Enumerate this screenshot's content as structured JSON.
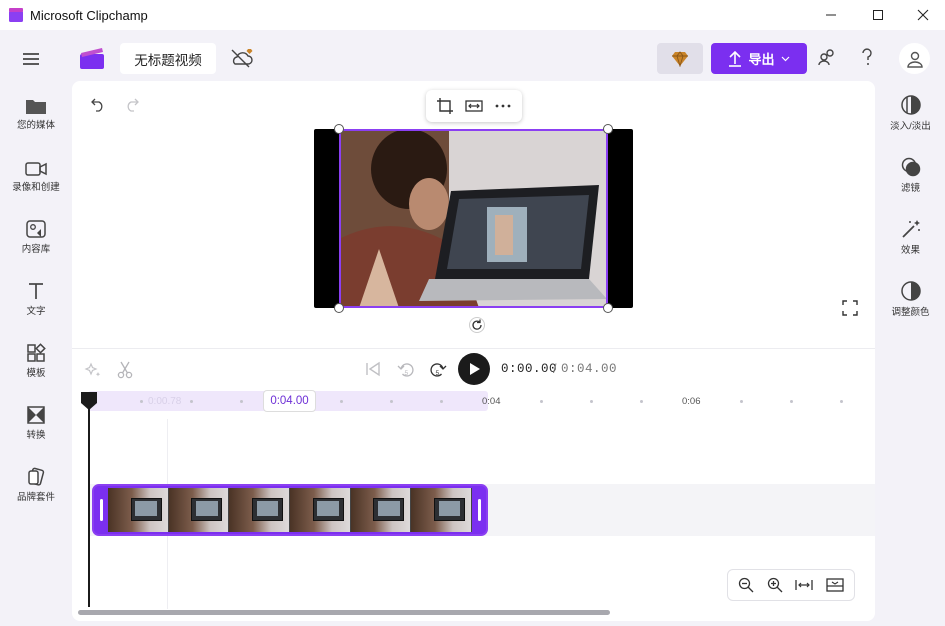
{
  "window": {
    "title": "Microsoft Clipchamp",
    "controls": [
      "minimize",
      "maximize",
      "close"
    ]
  },
  "topbar": {
    "project_title": "无标题视频",
    "export_label": "导出",
    "icons": [
      "menu-icon",
      "clipchamp-logo-icon",
      "cloud-off-icon",
      "premium-diamond-icon",
      "upload-icon",
      "chevron-down-icon",
      "share-people-icon",
      "help-icon",
      "user-avatar-icon"
    ]
  },
  "left_nav": {
    "items": [
      {
        "label": "您的媒体",
        "icon": "folder-icon"
      },
      {
        "label": "录像和创建",
        "icon": "video-camera-icon"
      },
      {
        "label": "内容库",
        "icon": "library-icon"
      },
      {
        "label": "文字",
        "icon": "text-icon"
      },
      {
        "label": "模板",
        "icon": "templates-icon"
      },
      {
        "label": "转换",
        "icon": "transitions-icon"
      },
      {
        "label": "品牌套件",
        "icon": "brand-kit-icon"
      }
    ]
  },
  "right_nav": {
    "items": [
      {
        "label": "淡入/淡出",
        "icon": "fade-icon"
      },
      {
        "label": "滤镜",
        "icon": "filters-icon"
      },
      {
        "label": "效果",
        "icon": "effects-wand-icon"
      },
      {
        "label": "调整颜色",
        "icon": "adjust-colors-icon"
      }
    ]
  },
  "preview": {
    "toolbar": [
      "crop-icon",
      "fit-icon",
      "more-icon"
    ],
    "icons": [
      "undo-icon",
      "redo-icon",
      "rotate-icon",
      "fullscreen-icon"
    ]
  },
  "playback": {
    "current_time": "0:00.00",
    "separator": "/",
    "total_time": "0:04.00"
  },
  "timeline": {
    "ghost_label": "0:00.78",
    "time_chip": "0:04.00",
    "ruler_labels": [
      "0:04",
      "0:06"
    ],
    "clip_frames": 6,
    "zoom_tools": [
      "zoom-out-icon",
      "zoom-in-icon",
      "fit-timeline-icon",
      "expand-timeline-icon"
    ]
  },
  "colors": {
    "accent": "#7b2ff0",
    "background": "#f3f2f8"
  }
}
